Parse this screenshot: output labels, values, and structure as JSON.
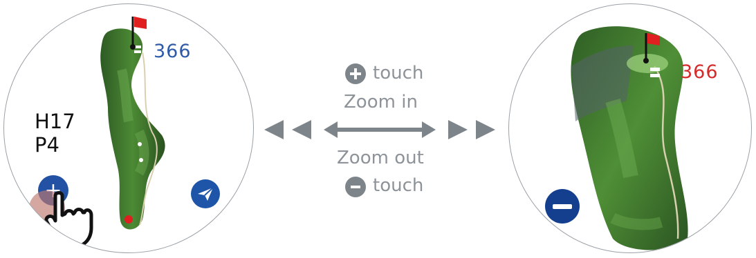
{
  "left_watch": {
    "distance": "366",
    "hole": "H17",
    "par": "P4",
    "colors": {
      "distance": "#2f5aa8",
      "button": "#2352a4"
    }
  },
  "right_watch": {
    "distance": "366",
    "colors": {
      "distance": "#d42a2a",
      "button": "#143f8e"
    }
  },
  "instructions": {
    "zoom_in": "Zoom in",
    "zoom_out": "Zoom out",
    "touch_plus": "touch",
    "touch_minus": "touch",
    "plus_symbol": "+",
    "minus_symbol": "−"
  },
  "icons": {
    "plus_button": "plus-icon",
    "minus_button": "minus-icon",
    "send_button": "paper-plane-icon",
    "hand": "pointing-hand-icon",
    "flag": "flag-icon",
    "arrows": "double-headed-arrow-icon"
  }
}
